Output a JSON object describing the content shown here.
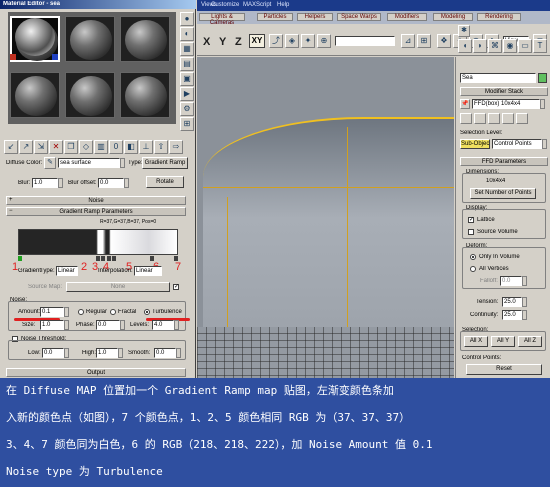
{
  "material_editor": {
    "title": "Material Editor - sea",
    "diffuse_color_label": "Diffuse Color:",
    "map_name": "sea surface",
    "type_label": "Type:",
    "type_value": "Gradient Ramp",
    "blur_label": "Blur:",
    "blur_value": "1.0",
    "blur_offset_label": "Blur offset:",
    "blur_offset_value": "0.0",
    "rotate_label": "Rotate",
    "noise_rollout": "Noise",
    "gradient_rollout": "Gradient Ramp Parameters",
    "ramp_readout": "R=37,G=37,B=37, Pos=0",
    "gradient_type_label": "Gradient",
    "gradient_type_sub": "Type:",
    "gradient_type_value": "Linear",
    "interpolation_label": "Interpolation:",
    "interpolation_value": "Linear",
    "source_map_label": "Source Map:",
    "source_map_value": "None",
    "noise_label": "Noise:",
    "amount_label": "Amount:",
    "amount_value": "0.1",
    "regular_label": "Regular",
    "fractal_label": "Fractal",
    "turbulence_label": "Turbulence",
    "size_label": "Size:",
    "size_value": "1.0",
    "phase_label": "Phase:",
    "phase_value": "0.0",
    "levels_label": "Levels:",
    "levels_value": "4.0",
    "noise_threshold_label": "Noise Threshold:",
    "low_label": "Low:",
    "low_value": "0.0",
    "high_label": "High:",
    "high_value": "1.0",
    "smooth_label": "Smooth:",
    "smooth_value": "0.0",
    "output_rollout": "Output",
    "marker_numbers": [
      "1",
      "2",
      "3",
      "4",
      "5",
      "6",
      "7"
    ]
  },
  "max_menu": {
    "items": [
      "Views",
      "Customize",
      "MAXScript",
      "Help"
    ]
  },
  "max_tabs": [
    "Lights & Cameras",
    "Particles",
    "Helpers",
    "Space Warps",
    "Modifiers",
    "Modeling",
    "Rendering"
  ],
  "axis_buttons": [
    "X",
    "Y",
    "Z",
    "XY"
  ],
  "view_dropdown": "View",
  "command_panel": {
    "object_name": "Sea",
    "modifier_stack_label": "Modifier Stack",
    "stack_item": "FFD(box) 10x4x4",
    "selection_level_label": "Selection Level:",
    "sub_object_label": "Sub-Object",
    "sub_object_value": "Control Points",
    "ffd_params_label": "FFD Parameters",
    "dimensions_label": "Dimensions:",
    "dimensions_value": "10x4x4",
    "set_points_label": "Set Number of Points",
    "display_label": "Display:",
    "lattice_label": "Lattice",
    "source_volume_label": "Source Volume",
    "deform_label": "Deform:",
    "only_in_volume_label": "Only In Volume",
    "all_vertices_label": "All Vertices",
    "falloff_label": "Falloff:",
    "falloff_value": "0.0",
    "tension_label": "Tension:",
    "tension_value": "25.0",
    "continuity_label": "Continuity:",
    "continuity_value": "25.0",
    "selection_label": "Selection:",
    "all_x": "All X",
    "all_y": "All Y",
    "all_z": "All Z",
    "control_points_label": "Control Points:",
    "reset_label": "Reset"
  },
  "caption": {
    "line1": "在 Diffuse MAP 位置加一个 Gradient Ramp map 贴图，左渐变颜色条加",
    "line2": "入新的颜色点（如图），7 个颜色点，1、2、5 颜色相同 RGB 为（37、37、37）",
    "line3": "3、4、7 颜色同为白色，6 的 RGB（218、218、222），加 Noise Amount 值 0.1",
    "line4": "Noise type 为 Turbulence"
  },
  "colors": {
    "caption_bg": "#2f4fa0",
    "annotation_red": "#e02020",
    "max_titlebar": "#1b3a8a",
    "viewport_bg": "#8b9199",
    "sub_object_yellow": "#f0e060"
  },
  "icons": [
    "material-sample-sphere",
    "toolbar-icon",
    "red-underline",
    "wireframe-grid"
  ]
}
